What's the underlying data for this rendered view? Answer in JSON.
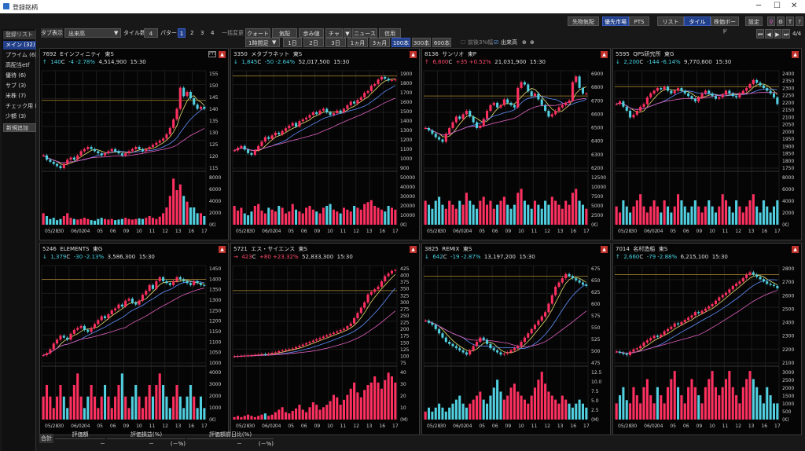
{
  "window": {
    "title": "登録銘柄"
  },
  "toolbar": {
    "right_buttons": [
      "先物気配",
      "優先市場",
      "PTS",
      "リスト",
      "タイル",
      "株価ボード",
      "設定"
    ],
    "page": "4/4",
    "tab_label": "タブ表示",
    "tab_value": "出来高",
    "tile_label": "タイル数",
    "tile_value": "4",
    "pattern_label": "パターン",
    "patterns": [
      "1",
      "2",
      "3",
      "4"
    ],
    "bulk_label": "一括変更",
    "mode_buttons": [
      "クォート",
      "気配",
      "歩み値",
      "チャート",
      "▼",
      "ニュース",
      "信用"
    ],
    "period": "1時間足",
    "ranges": [
      "1日",
      "2日",
      "3日",
      "1ヵ月",
      "3ヵ月",
      "100本",
      "300本",
      "600本"
    ],
    "chk1": "前後3%幅",
    "chk2": "出来高"
  },
  "sidebar": {
    "header": "登録リスト",
    "items": [
      "メイン (32)",
      "プライム (6)",
      "高配当etf",
      "優待 (6)",
      "サブ (3)",
      "米株 (7)",
      "チェック用 (",
      "少額 (3)"
    ],
    "add": "新規追加"
  },
  "x_labels": [
    "05/28",
    "30",
    "06/02",
    "04",
    "05",
    "06",
    "09",
    "10",
    "11",
    "12",
    "13",
    "16",
    "17"
  ],
  "panels": [
    {
      "code": "7692",
      "name": "Eインフィニティ",
      "mkt": "東S",
      "dir": "↑",
      "price": "140",
      "cm": "C",
      "chg": "-4 -2.78%",
      "vol": "4,514,900",
      "time": "15:30",
      "up": false,
      "pbtn": "PTS",
      "yt": [
        "155",
        "150",
        "145",
        "140",
        "135",
        "130",
        "125",
        "120",
        "115"
      ],
      "vt": [
        "8000",
        "6000",
        "4000",
        "2000",
        "(K)"
      ],
      "series": [
        118,
        116,
        115,
        114,
        113,
        112,
        114,
        116,
        117,
        116,
        118,
        120,
        121,
        122,
        121,
        120,
        119,
        118,
        119,
        120,
        121,
        120,
        119,
        118,
        119,
        120,
        121,
        122,
        121,
        120,
        121,
        122,
        123,
        124,
        125,
        126,
        128,
        131,
        135,
        140,
        150,
        146,
        148,
        145,
        142,
        140,
        141,
        140
      ],
      "vols": [
        2,
        1.5,
        1,
        1.2,
        0.8,
        1,
        1.5,
        2,
        1.2,
        1,
        0.9,
        1,
        1.2,
        1,
        0.8,
        0.7,
        1,
        1.2,
        1,
        0.9,
        1,
        0.8,
        0.9,
        1,
        1.2,
        1,
        0.9,
        1,
        1.1,
        1,
        1.2,
        1.5,
        1.2,
        1,
        1.4,
        2,
        3,
        5,
        8,
        6,
        7,
        5,
        4,
        3,
        3,
        2,
        2,
        1.5
      ],
      "ymin": 112,
      "ymax": 158,
      "vmax": 9,
      "line": 144
    },
    {
      "code": "3350",
      "name": "メタプラネット",
      "mkt": "東S",
      "dir": "↓",
      "price": "1,845",
      "cm": "C",
      "chg": "-50 -2.64%",
      "vol": "52,017,500",
      "time": "15:30",
      "up": false,
      "yt": [
        "1900",
        "1800",
        "1700",
        "1600",
        "1500",
        "1400",
        "1300",
        "1200",
        "1100",
        "1000",
        "900"
      ],
      "vt": [
        "50000",
        "40000",
        "30000",
        "20000",
        "10000",
        "(K)"
      ],
      "series": [
        1050,
        1080,
        1100,
        1060,
        1020,
        1000,
        1050,
        1100,
        1150,
        1200,
        1180,
        1220,
        1250,
        1230,
        1270,
        1300,
        1330,
        1360,
        1320,
        1380,
        1400,
        1420,
        1450,
        1480,
        1460,
        1500,
        1520,
        1480,
        1450,
        1470,
        1500,
        1480,
        1520,
        1560,
        1600,
        1580,
        1620,
        1650,
        1700,
        1720,
        1780,
        1800,
        1850,
        1880,
        1860,
        1840,
        1845,
        1850
      ],
      "vols": [
        20,
        15,
        18,
        12,
        10,
        14,
        20,
        22,
        15,
        12,
        18,
        16,
        14,
        20,
        18,
        12,
        14,
        22,
        16,
        14,
        12,
        18,
        20,
        16,
        14,
        12,
        18,
        20,
        22,
        16,
        14,
        12,
        18,
        16,
        14,
        20,
        18,
        16,
        22,
        24,
        26,
        20,
        18,
        16,
        14,
        20,
        18,
        16
      ],
      "ymin": 850,
      "ymax": 1950,
      "vmax": 55000,
      "line": 1890
    },
    {
      "code": "8136",
      "name": "サンリオ",
      "mkt": "東P",
      "dir": "↑",
      "price": "6,800",
      "cm": "C",
      "chg": "+35 +0.52%",
      "vol": "21,031,900",
      "time": "15:30",
      "up": true,
      "yt": [
        "6900",
        "6800",
        "6700",
        "6600",
        "6500",
        "6400",
        "6300",
        "6200"
      ],
      "vt": [
        "12500",
        "10000",
        "7500",
        "5000",
        "2500",
        "(K)"
      ],
      "series": [
        6500,
        6480,
        6450,
        6420,
        6400,
        6380,
        6450,
        6500,
        6550,
        6600,
        6580,
        6620,
        6650,
        6600,
        6550,
        6500,
        6520,
        6580,
        6650,
        6700,
        6720,
        6680,
        6700,
        6750,
        6720,
        6700,
        6680,
        6850,
        6900,
        6880,
        6820,
        6780,
        6800,
        6750,
        6700,
        6650,
        6600,
        6620,
        6650,
        6680,
        6700,
        6720,
        6740,
        6900,
        6950,
        6850,
        6800,
        6800
      ],
      "vols": [
        6,
        5,
        4,
        6,
        7,
        5,
        4,
        6,
        5,
        4,
        6,
        5,
        8,
        6,
        5,
        4,
        6,
        7,
        5,
        6,
        4,
        5,
        6,
        7,
        5,
        4,
        5,
        8,
        9,
        6,
        5,
        4,
        6,
        5,
        4,
        6,
        5,
        7,
        6,
        5,
        4,
        6,
        5,
        8,
        9,
        6,
        5,
        4
      ],
      "ymin": 6150,
      "ymax": 7000,
      "vmax": 13000,
      "line": 6780
    },
    {
      "code": "5595",
      "name": "QPS研究所",
      "mkt": "東G",
      "dir": "↓",
      "price": "2,200",
      "cm": "C",
      "chg": "-144 -6.14%",
      "vol": "9,770,600",
      "time": "15:30",
      "up": false,
      "yt": [
        "2400",
        "2350",
        "2300",
        "2250",
        "2200",
        "2150",
        "2100",
        "2050",
        "2000",
        "1950",
        "1900",
        "1850",
        "1800",
        "1750"
      ],
      "vt": [
        "8000",
        "6000",
        "4000",
        "2000",
        "(K)"
      ],
      "series": [
        2200,
        2220,
        2180,
        2150,
        2100,
        2120,
        2150,
        2180,
        2200,
        2250,
        2280,
        2300,
        2320,
        2310,
        2330,
        2300,
        2280,
        2300,
        2320,
        2300,
        2280,
        2260,
        2240,
        2220,
        2250,
        2280,
        2300,
        2280,
        2260,
        2240,
        2250,
        2270,
        2300,
        2280,
        2260,
        2250,
        2280,
        2300,
        2320,
        2350,
        2380,
        2360,
        2340,
        2320,
        2300,
        2280,
        2250,
        2200
      ],
      "vols": [
        3,
        2,
        4,
        3,
        2,
        3,
        4,
        5,
        3,
        2,
        3,
        4,
        3,
        2,
        4,
        3,
        2,
        3,
        5,
        4,
        3,
        2,
        3,
        4,
        3,
        2,
        3,
        4,
        3,
        2,
        3,
        5,
        4,
        3,
        2,
        4,
        3,
        2,
        3,
        4,
        5,
        3,
        2,
        4,
        3,
        2,
        3,
        4
      ],
      "ymin": 1720,
      "ymax": 2450,
      "vmax": 8500,
      "line": 2330
    },
    {
      "code": "5246",
      "name": "ELEMENTS",
      "mkt": "東G",
      "dir": "↓",
      "price": "1,379",
      "cm": "C",
      "chg": "-30 -2.13%",
      "vol": "3,586,300",
      "time": "15:30",
      "up": false,
      "yt": [
        "1450",
        "1400",
        "1350",
        "1300",
        "1250",
        "1200",
        "1150",
        "1100",
        "1050",
        "1000"
      ],
      "vt": [
        "4000",
        "3000",
        "2000",
        "1000",
        "(K)"
      ],
      "series": [
        1020,
        1030,
        1050,
        1080,
        1100,
        1120,
        1110,
        1100,
        1130,
        1150,
        1160,
        1170,
        1150,
        1140,
        1160,
        1180,
        1200,
        1220,
        1210,
        1230,
        1250,
        1260,
        1280,
        1270,
        1300,
        1310,
        1290,
        1280,
        1300,
        1330,
        1350,
        1380,
        1360,
        1400,
        1420,
        1400,
        1390,
        1380,
        1400,
        1420,
        1410,
        1400,
        1390,
        1380,
        1400,
        1390,
        1380,
        1379
      ],
      "vols": [
        2,
        3,
        2,
        1,
        2,
        3,
        2,
        1,
        2,
        3,
        4,
        2,
        1,
        2,
        3,
        2,
        1,
        2,
        3,
        2,
        1,
        2,
        3,
        4,
        2,
        1,
        2,
        3,
        2,
        1,
        2,
        3,
        2,
        3,
        4,
        3,
        2,
        1,
        2,
        3,
        2,
        1,
        2,
        3,
        2,
        1,
        2,
        1
      ],
      "ymin": 980,
      "ymax": 1480,
      "vmax": 4500,
      "line": 1410
    },
    {
      "code": "5721",
      "name": "エス・サイエンス",
      "mkt": "東S",
      "dir": "→",
      "price": "423",
      "cm": "C",
      "chg": "+80 +23.32%",
      "vol": "52,833,300",
      "time": "15:30",
      "up": true,
      "yt": [
        "425",
        "400",
        "375",
        "350",
        "325",
        "300",
        "275",
        "250",
        "225",
        "200",
        "175",
        "150",
        "125",
        "100",
        "75"
      ],
      "vt": [
        "40",
        "30",
        "20",
        "10",
        "(M)"
      ],
      "series": [
        95,
        96,
        97,
        98,
        99,
        100,
        101,
        102,
        104,
        103,
        105,
        108,
        110,
        115,
        118,
        120,
        122,
        125,
        130,
        135,
        140,
        145,
        150,
        155,
        160,
        165,
        170,
        175,
        180,
        185,
        190,
        195,
        200,
        210,
        220,
        240,
        260,
        280,
        300,
        330,
        340,
        350,
        360,
        380,
        400,
        410,
        420,
        423
      ],
      "vols": [
        2,
        3,
        2,
        3,
        4,
        3,
        2,
        3,
        4,
        5,
        3,
        4,
        6,
        8,
        10,
        6,
        5,
        7,
        9,
        12,
        8,
        6,
        10,
        14,
        12,
        8,
        10,
        12,
        15,
        20,
        18,
        12,
        16,
        20,
        25,
        30,
        22,
        18,
        24,
        28,
        30,
        35,
        30,
        25,
        32,
        38,
        35,
        30
      ],
      "ymin": 70,
      "ymax": 440,
      "vmax": 42,
      "line": 345
    },
    {
      "code": "3825",
      "name": "REMIX",
      "mkt": "東S",
      "dir": "↓",
      "price": "642",
      "cm": "C",
      "chg": "-19 -2.87%",
      "vol": "13,197,200",
      "time": "15:30",
      "up": false,
      "yt": [
        "675",
        "650",
        "625",
        "600",
        "575",
        "550",
        "525",
        "500",
        "475"
      ],
      "vt": [
        "12.5",
        "10.0",
        "7.5",
        "5.0",
        "2.5",
        "(M)"
      ],
      "series": [
        560,
        555,
        550,
        540,
        530,
        520,
        510,
        505,
        500,
        495,
        490,
        485,
        480,
        490,
        500,
        510,
        520,
        515,
        505,
        495,
        490,
        485,
        480,
        482,
        485,
        490,
        495,
        500,
        510,
        520,
        530,
        540,
        550,
        560,
        570,
        580,
        600,
        620,
        640,
        650,
        660,
        670,
        665,
        660,
        655,
        650,
        645,
        642
      ],
      "vols": [
        2,
        3,
        2,
        3,
        4,
        3,
        2,
        3,
        4,
        5,
        6,
        4,
        3,
        4,
        5,
        6,
        7,
        5,
        4,
        6,
        8,
        10,
        7,
        5,
        6,
        8,
        9,
        7,
        6,
        5,
        4,
        6,
        8,
        10,
        12,
        9,
        7,
        6,
        5,
        4,
        6,
        5,
        4,
        3,
        4,
        5,
        4,
        3
      ],
      "ymin": 460,
      "ymax": 690,
      "vmax": 13,
      "line": 665
    },
    {
      "code": "7014",
      "name": "名村造船",
      "mkt": "東S",
      "dir": "↑",
      "price": "2,660",
      "cm": "C",
      "chg": "-79 -2.88%",
      "vol": "6,215,100",
      "time": "15:30",
      "up": false,
      "yt": [
        "2800",
        "2700",
        "2600",
        "2500",
        "2400",
        "2300",
        "2200",
        "2100"
      ],
      "vt": [
        "3000",
        "2500",
        "2000",
        "1500",
        "1000",
        "500",
        "(K)"
      ],
      "series": [
        2100,
        2090,
        2080,
        2070,
        2100,
        2120,
        2130,
        2150,
        2180,
        2200,
        2220,
        2240,
        2230,
        2250,
        2280,
        2300,
        2320,
        2350,
        2340,
        2360,
        2380,
        2400,
        2420,
        2450,
        2440,
        2460,
        2480,
        2500,
        2520,
        2550,
        2580,
        2600,
        2620,
        2650,
        2680,
        2700,
        2720,
        2750,
        2780,
        2800,
        2780,
        2760,
        2740,
        2720,
        2700,
        2690,
        2680,
        2660
      ],
      "vols": [
        1,
        1.5,
        2,
        1.2,
        1,
        2,
        1.5,
        1,
        2,
        2.5,
        1.5,
        1,
        2,
        1.5,
        1,
        2,
        2.5,
        3,
        2,
        1.5,
        1,
        2,
        2.5,
        2,
        1.5,
        1,
        2,
        2.5,
        3,
        2,
        1.5,
        2,
        2.5,
        3,
        2,
        1.5,
        1,
        2,
        2.5,
        3,
        2.5,
        2,
        1.5,
        1,
        2,
        1.5,
        1,
        1
      ],
      "ymin": 2000,
      "ymax": 2860,
      "vmax": 3200,
      "line": 2780
    }
  ],
  "bottom": {
    "label": "合計",
    "headers": [
      "評価額",
      "評価損益(%)",
      "評価額前日比(%)"
    ],
    "values": [
      "－",
      "－",
      "(－%)",
      "－",
      "(－%)"
    ]
  }
}
